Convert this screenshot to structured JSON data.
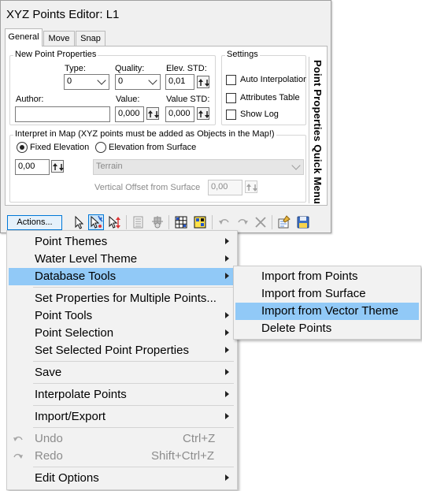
{
  "window": {
    "title": "XYZ Points Editor: L1"
  },
  "tabs": [
    {
      "label": "General",
      "active": true
    },
    {
      "label": "Move",
      "active": false
    },
    {
      "label": "Snap",
      "active": false
    }
  ],
  "new_point": {
    "legend": "New Point Properties",
    "type_label": "Type:",
    "type_value": "0",
    "quality_label": "Quality:",
    "quality_value": "0",
    "elev_std_label": "Elev. STD:",
    "elev_std_value": "0,01",
    "author_label": "Author:",
    "author_value": "",
    "value_label": "Value:",
    "value_value": "0,000",
    "value_std_label": "Value STD:",
    "value_std_value": "0,000"
  },
  "settings": {
    "legend": "Settings",
    "auto_interpolation": {
      "label": "Auto Interpolation",
      "checked": false
    },
    "attributes_table": {
      "label": "Attributes Table",
      "checked": false
    },
    "show_log": {
      "label": "Show Log",
      "checked": false
    }
  },
  "interpret": {
    "legend": "Interpret in Map (XYZ points must be added as Objects in the Map!)",
    "fixed_elevation": {
      "label": "Fixed Elevation",
      "selected": true
    },
    "elevation_from_surface": {
      "label": "Elevation from Surface",
      "selected": false
    },
    "elevation_value": "0,00",
    "surface_value": "Terrain",
    "vertical_offset_label": "Vertical Offset from Surface",
    "vertical_offset_value": "0,00"
  },
  "quick_menu": {
    "label": "Point Properties Quick Menu"
  },
  "toolbar": {
    "actions_label": "Actions...",
    "icons": [
      "select-arrow-icon",
      "add-point-icon",
      "move-vertical-icon",
      "table-icon",
      "settings-icon",
      "grid-icon",
      "color-grid-icon",
      "undo-icon",
      "redo-icon",
      "delete-icon",
      "properties-icon",
      "save-icon"
    ]
  },
  "actions_menu": {
    "items": [
      {
        "label": "Point Themes",
        "submenu": true
      },
      {
        "label": "Water Level Theme",
        "submenu": true
      },
      {
        "label": "Database Tools",
        "submenu": true,
        "highlighted": true
      },
      {
        "label": "Set Properties for Multiple Points...",
        "submenu": false
      },
      {
        "label": "Point Tools",
        "submenu": true
      },
      {
        "label": "Point Selection",
        "submenu": true
      },
      {
        "label": "Set Selected Point Properties",
        "submenu": true
      },
      {
        "label": "Save",
        "submenu": true
      },
      {
        "label": "Interpolate Points",
        "submenu": true
      },
      {
        "label": "Import/Export",
        "submenu": true
      },
      {
        "label": "Undo",
        "shortcut": "Ctrl+Z",
        "disabled": true,
        "icon": "undo-icon"
      },
      {
        "label": "Redo",
        "shortcut": "Shift+Ctrl+Z",
        "disabled": true,
        "icon": "redo-icon"
      },
      {
        "label": "Edit Options",
        "submenu": true
      }
    ]
  },
  "database_submenu": {
    "items": [
      {
        "label": "Import from Points"
      },
      {
        "label": "Import from Surface"
      },
      {
        "label": "Import from Vector Theme",
        "highlighted": true
      },
      {
        "label": "Delete Points"
      }
    ]
  },
  "colors": {
    "highlight": "#91c9f7",
    "accent": "#0078d7",
    "menu_bg": "#f2f2f2"
  }
}
